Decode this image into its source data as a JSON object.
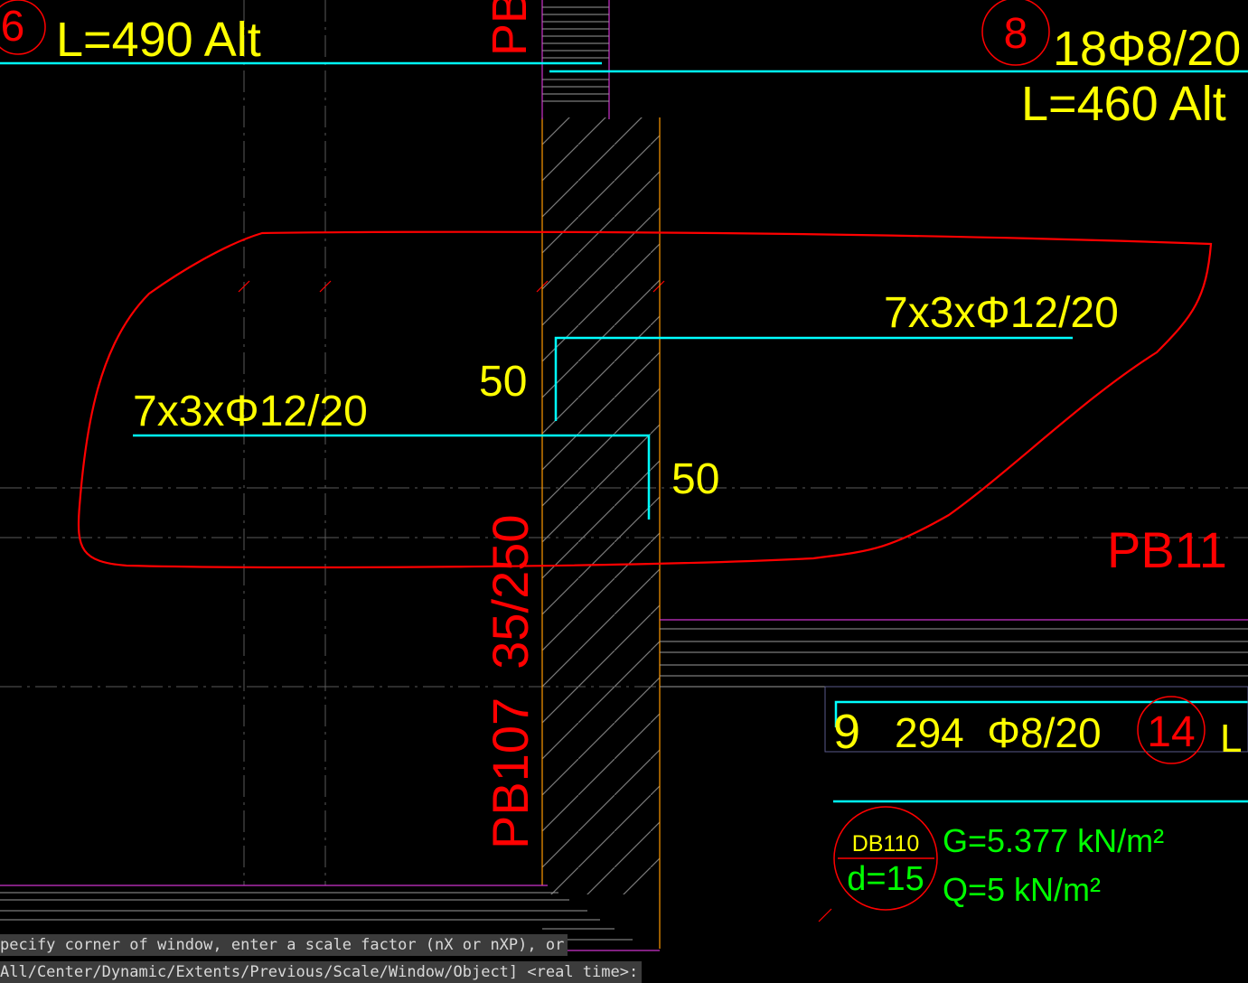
{
  "drawing": {
    "labels": {
      "top_left_length": "L=490 Alt",
      "top_left_marker": "6",
      "top_pb_fragment": "PB",
      "top_right_marker": "8",
      "top_right_bars": "18Φ8/20",
      "top_right_length": "L=460 Alt",
      "upper_reinforcement": "7x3xΦ12/20",
      "lower_reinforcement": "7x3xΦ12/20",
      "dim_upper": "50",
      "dim_lower": "50",
      "beam_label": "PB107  35/250",
      "right_pb_fragment": "PB11",
      "row_marker_num": "9",
      "row_bars": "294  Φ8/20",
      "row_marker_circle": "14",
      "row_tail": "L",
      "slab_id": "DB110",
      "slab_thickness": "d=15",
      "load_g": "G=5.377 kN/m²",
      "load_q": "Q=5 kN/m²"
    },
    "colors": {
      "background": "#000000",
      "yellow_text": "#ffff00",
      "red_text": "#ff0000",
      "cyan_lines": "#00ffff",
      "green_text": "#00ff00",
      "magenta_lines": "#cc33cc",
      "orange_lines": "#ff9900",
      "hatch": "#808080"
    }
  },
  "command_line": {
    "line1": "pecify corner of window, enter a scale factor (nX or nXP), or",
    "line2": "All/Center/Dynamic/Extents/Previous/Scale/Window/Object] <real time>:"
  }
}
